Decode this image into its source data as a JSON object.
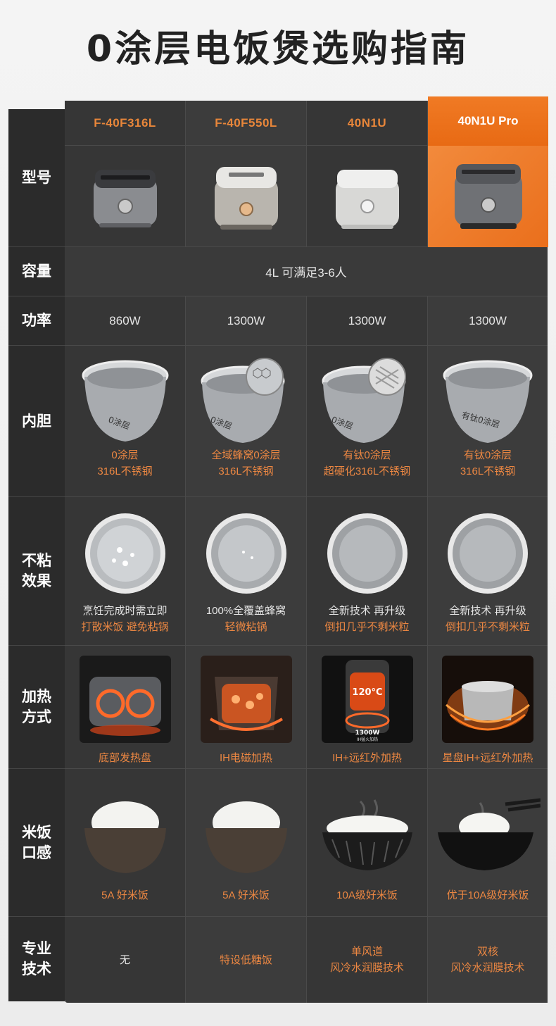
{
  "title": "0涂层电饭煲选购指南",
  "row_labels": {
    "model": "型号",
    "capacity": "容量",
    "power": "功率",
    "pot": "内胆",
    "nonstick": "不粘\n效果",
    "heating": "加热\n方式",
    "texture": "米饭\n口感",
    "tech": "专业\n技术"
  },
  "capacity_text": "4L 可满足3-6人",
  "products": [
    {
      "model": "F-40F316L",
      "power": "860W",
      "pot": [
        "0涂层",
        "316L不锈钢"
      ],
      "nonstick": [
        "烹饪完成时需立即",
        "打散米饭 避免粘锅"
      ],
      "heating": "底部发热盘",
      "texture": "5A 好米饭",
      "tech": [
        "无"
      ]
    },
    {
      "model": "F-40F550L",
      "power": "1300W",
      "pot": [
        "全域蜂窝0涂层",
        "316L不锈钢"
      ],
      "nonstick": [
        "100%全覆盖蜂窝",
        "轻微粘锅"
      ],
      "heating": "IH电磁加热",
      "texture": "5A 好米饭",
      "tech": [
        "特设低糖饭"
      ]
    },
    {
      "model": "40N1U",
      "power": "1300W",
      "pot": [
        "有钛0涂层",
        "超硬化316L不锈钢"
      ],
      "nonstick": [
        "全新技术 再升级",
        "倒扣几乎不剩米粒"
      ],
      "heating": "IH+远红外加热",
      "texture": "10A级好米饭",
      "tech": [
        "单风道",
        "风冷水润膜技术"
      ]
    },
    {
      "model": "40N1U Pro",
      "power": "1300W",
      "pot": [
        "有钛0涂层",
        "316L不锈钢"
      ],
      "nonstick": [
        "全新技术 再升级",
        "倒扣几乎不剩米粒"
      ],
      "heating": "星盘IH+远红外加热",
      "texture": "优于10A级好米饭",
      "tech": [
        "双核",
        "风冷水润膜技术"
      ]
    }
  ],
  "heat_image_text": {
    "temp": "120°C",
    "power": "1300W",
    "sub": "IH猛火加热"
  },
  "colors": {
    "accent": "#e8863a",
    "pro_header": "#ee7420",
    "panel": "#363636"
  }
}
